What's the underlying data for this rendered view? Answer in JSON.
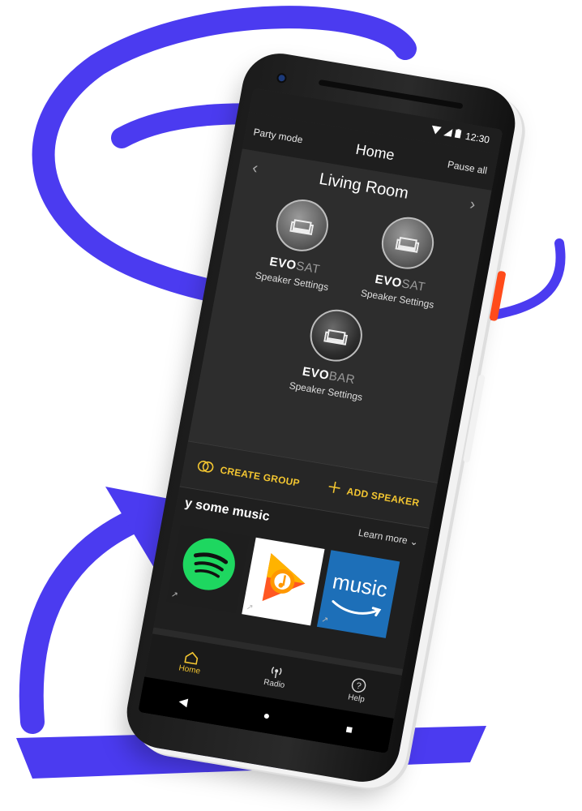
{
  "status": {
    "time": "12:30",
    "wifi_icon": "wifi-icon",
    "signal_icon": "signal-icon",
    "battery_icon": "battery-icon"
  },
  "topbar": {
    "left": "Party mode",
    "title": "Home",
    "right": "Pause all"
  },
  "room": {
    "title": "Living Room",
    "prev_icon": "‹",
    "next_icon": "›",
    "speakers": [
      {
        "model_bold": "EVO",
        "model_light": "SAT",
        "link": "Speaker Settings"
      },
      {
        "model_bold": "EVO",
        "model_light": "SAT",
        "link": "Speaker Settings"
      },
      {
        "model_bold": "EVO",
        "model_light": "BAR",
        "link": "Speaker Settings"
      }
    ]
  },
  "actions": {
    "create_group": "CREATE GROUP",
    "add_speaker": "ADD SPEAKER"
  },
  "music": {
    "title": "y some music",
    "learn_more": "Learn more",
    "amazon_label": "music"
  },
  "nav": {
    "home": "Home",
    "radio": "Radio",
    "help": "Help"
  },
  "colors": {
    "accent": "#f2c531",
    "scribble": "#4b3bf0",
    "power_button": "#ff4b1a",
    "screen_bg": "#2b2b2b"
  }
}
